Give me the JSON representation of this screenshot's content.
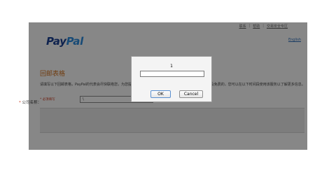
{
  "header": {
    "links": [
      "联系",
      "帮助",
      "交易安全专区"
    ],
    "separator": "|",
    "logo": {
      "part1": "Pay",
      "part2": "Pal"
    },
    "language_link": "English"
  },
  "form": {
    "title": "回邮表格",
    "intro": "请填写以下回邮表格，PayPal的代表会尽快联络您，为您提供专业的业务咨询服务。PayPal 特派员或聚惠用户及免费的，您可以在以下时间段使用该服务以了解更多信息。",
    "required_note": "* 必须填写",
    "fields": [
      {
        "required_mark": "*",
        "label": "公司名称：",
        "value": "\\"
      }
    ]
  },
  "dialog": {
    "message": "1",
    "input_value": "",
    "ok_label": "OK",
    "cancel_label": "Cancel"
  }
}
